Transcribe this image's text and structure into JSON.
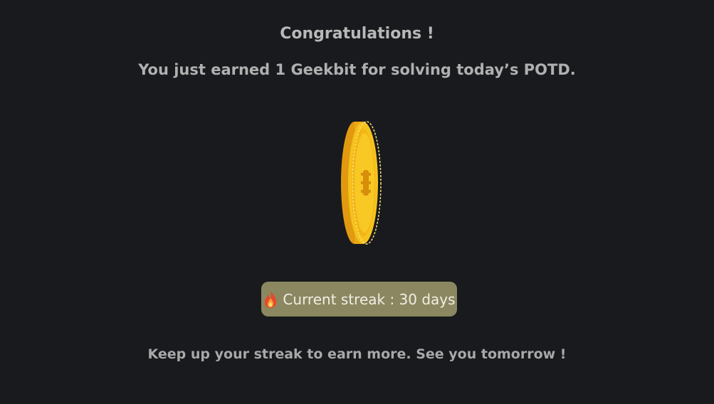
{
  "dialog": {
    "title": "Congratulations !",
    "message": "You just earned 1 Geekbit for solving today’s POTD.",
    "coin_icon": "geekbit-coin-icon",
    "streak": {
      "icon": "fire-icon",
      "text": "Current streak : 30 days"
    },
    "footer": "Keep up your streak to earn more. See you tomorrow !"
  },
  "colors": {
    "background": "#181a1d",
    "streak_badge": "#8b8760",
    "coin_gold": "#f5c518"
  }
}
